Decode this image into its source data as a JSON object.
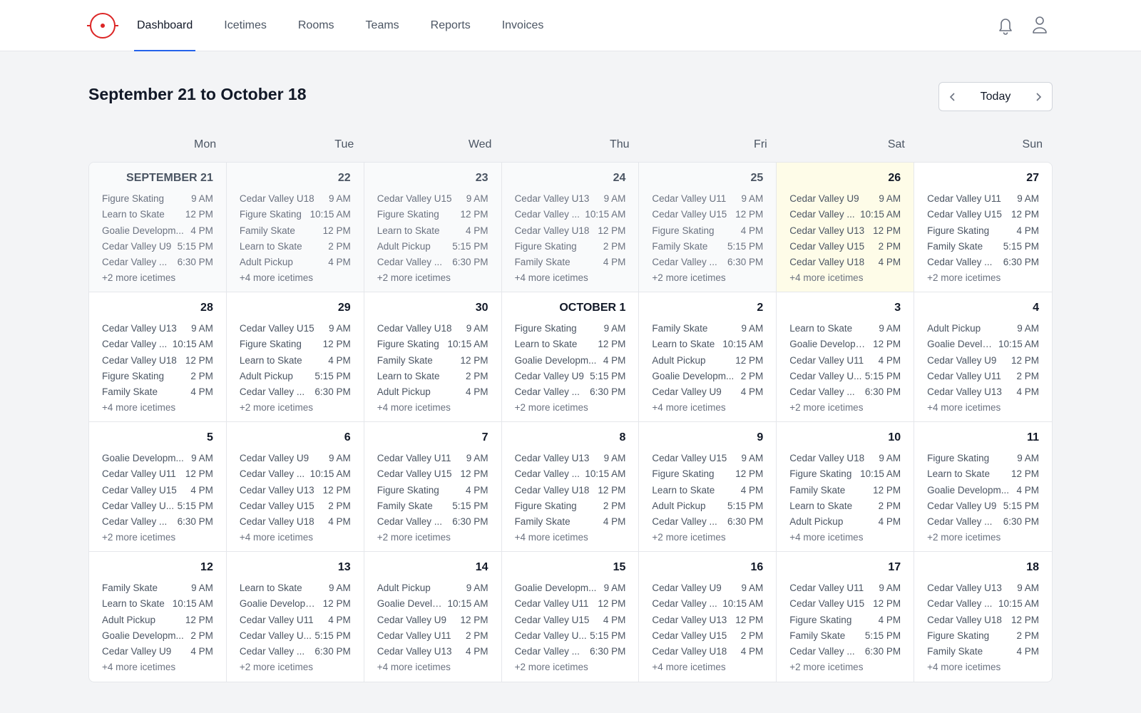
{
  "nav": {
    "tabs": [
      {
        "label": "Dashboard",
        "active": true
      },
      {
        "label": "Icetimes",
        "active": false
      },
      {
        "label": "Rooms",
        "active": false
      },
      {
        "label": "Teams",
        "active": false
      },
      {
        "label": "Reports",
        "active": false
      },
      {
        "label": "Invoices",
        "active": false
      }
    ],
    "icons": [
      "bell-icon",
      "user-icon"
    ],
    "accent_color": "#2563eb",
    "brand_color": "#dc2626"
  },
  "header": {
    "title": "September 21 to October 18",
    "today_label": "Today"
  },
  "calendar": {
    "weekdays": [
      "Mon",
      "Tue",
      "Wed",
      "Thu",
      "Fri",
      "Sat",
      "Sun"
    ],
    "today_color": "#fefce8",
    "days": [
      {
        "label": "SEPTEMBER 21",
        "state": "past",
        "events": [
          {
            "name": "Figure Skating",
            "time": "9 AM"
          },
          {
            "name": "Learn to Skate",
            "time": "12 PM"
          },
          {
            "name": "Goalie Developm...",
            "time": "4 PM"
          },
          {
            "name": "Cedar Valley U9",
            "time": "5:15 PM"
          },
          {
            "name": "Cedar Valley ...",
            "time": "6:30 PM"
          }
        ],
        "more": "+2 more icetimes"
      },
      {
        "label": "22",
        "state": "past",
        "events": [
          {
            "name": "Cedar Valley U18",
            "time": "9 AM"
          },
          {
            "name": "Figure Skating",
            "time": "10:15 AM"
          },
          {
            "name": "Family Skate",
            "time": "12 PM"
          },
          {
            "name": "Learn to Skate",
            "time": "2 PM"
          },
          {
            "name": "Adult Pickup",
            "time": "4 PM"
          }
        ],
        "more": "+4 more icetimes"
      },
      {
        "label": "23",
        "state": "past",
        "events": [
          {
            "name": "Cedar Valley U15",
            "time": "9 AM"
          },
          {
            "name": "Figure Skating",
            "time": "12 PM"
          },
          {
            "name": "Learn to Skate",
            "time": "4 PM"
          },
          {
            "name": "Adult Pickup",
            "time": "5:15 PM"
          },
          {
            "name": "Cedar Valley ...",
            "time": "6:30 PM"
          }
        ],
        "more": "+2 more icetimes"
      },
      {
        "label": "24",
        "state": "past",
        "events": [
          {
            "name": "Cedar Valley U13",
            "time": "9 AM"
          },
          {
            "name": "Cedar Valley ...",
            "time": "10:15 AM"
          },
          {
            "name": "Cedar Valley U18",
            "time": "12 PM"
          },
          {
            "name": "Figure Skating",
            "time": "2 PM"
          },
          {
            "name": "Family Skate",
            "time": "4 PM"
          }
        ],
        "more": "+4 more icetimes"
      },
      {
        "label": "25",
        "state": "past",
        "events": [
          {
            "name": "Cedar Valley U11",
            "time": "9 AM"
          },
          {
            "name": "Cedar Valley U15",
            "time": "12 PM"
          },
          {
            "name": "Figure Skating",
            "time": "4 PM"
          },
          {
            "name": "Family Skate",
            "time": "5:15 PM"
          },
          {
            "name": "Cedar Valley ...",
            "time": "6:30 PM"
          }
        ],
        "more": "+2 more icetimes"
      },
      {
        "label": "26",
        "state": "today",
        "events": [
          {
            "name": "Cedar Valley U9",
            "time": "9 AM"
          },
          {
            "name": "Cedar Valley ...",
            "time": "10:15 AM"
          },
          {
            "name": "Cedar Valley U13",
            "time": "12 PM"
          },
          {
            "name": "Cedar Valley U15",
            "time": "2 PM"
          },
          {
            "name": "Cedar Valley U18",
            "time": "4 PM"
          }
        ],
        "more": "+4 more icetimes"
      },
      {
        "label": "27",
        "state": "future",
        "events": [
          {
            "name": "Cedar Valley U11",
            "time": "9 AM"
          },
          {
            "name": "Cedar Valley U15",
            "time": "12 PM"
          },
          {
            "name": "Figure Skating",
            "time": "4 PM"
          },
          {
            "name": "Family Skate",
            "time": "5:15 PM"
          },
          {
            "name": "Cedar Valley ...",
            "time": "6:30 PM"
          }
        ],
        "more": "+2 more icetimes"
      },
      {
        "label": "28",
        "state": "future",
        "events": [
          {
            "name": "Cedar Valley U13",
            "time": "9 AM"
          },
          {
            "name": "Cedar Valley ...",
            "time": "10:15 AM"
          },
          {
            "name": "Cedar Valley U18",
            "time": "12 PM"
          },
          {
            "name": "Figure Skating",
            "time": "2 PM"
          },
          {
            "name": "Family Skate",
            "time": "4 PM"
          }
        ],
        "more": "+4 more icetimes"
      },
      {
        "label": "29",
        "state": "future",
        "events": [
          {
            "name": "Cedar Valley U15",
            "time": "9 AM"
          },
          {
            "name": "Figure Skating",
            "time": "12 PM"
          },
          {
            "name": "Learn to Skate",
            "time": "4 PM"
          },
          {
            "name": "Adult Pickup",
            "time": "5:15 PM"
          },
          {
            "name": "Cedar Valley ...",
            "time": "6:30 PM"
          }
        ],
        "more": "+2 more icetimes"
      },
      {
        "label": "30",
        "state": "future",
        "events": [
          {
            "name": "Cedar Valley U18",
            "time": "9 AM"
          },
          {
            "name": "Figure Skating",
            "time": "10:15 AM"
          },
          {
            "name": "Family Skate",
            "time": "12 PM"
          },
          {
            "name": "Learn to Skate",
            "time": "2 PM"
          },
          {
            "name": "Adult Pickup",
            "time": "4 PM"
          }
        ],
        "more": "+4 more icetimes"
      },
      {
        "label": "OCTOBER 1",
        "state": "future",
        "events": [
          {
            "name": "Figure Skating",
            "time": "9 AM"
          },
          {
            "name": "Learn to Skate",
            "time": "12 PM"
          },
          {
            "name": "Goalie Developm...",
            "time": "4 PM"
          },
          {
            "name": "Cedar Valley U9",
            "time": "5:15 PM"
          },
          {
            "name": "Cedar Valley ...",
            "time": "6:30 PM"
          }
        ],
        "more": "+2 more icetimes"
      },
      {
        "label": "2",
        "state": "future",
        "events": [
          {
            "name": "Family Skate",
            "time": "9 AM"
          },
          {
            "name": "Learn to Skate",
            "time": "10:15 AM"
          },
          {
            "name": "Adult Pickup",
            "time": "12 PM"
          },
          {
            "name": "Goalie Developm...",
            "time": "2 PM"
          },
          {
            "name": "Cedar Valley U9",
            "time": "4 PM"
          }
        ],
        "more": "+4 more icetimes"
      },
      {
        "label": "3",
        "state": "future",
        "events": [
          {
            "name": "Learn to Skate",
            "time": "9 AM"
          },
          {
            "name": "Goalie Developm...",
            "time": "12 PM"
          },
          {
            "name": "Cedar Valley U11",
            "time": "4 PM"
          },
          {
            "name": "Cedar Valley U...",
            "time": "5:15 PM"
          },
          {
            "name": "Cedar Valley ...",
            "time": "6:30 PM"
          }
        ],
        "more": "+2 more icetimes"
      },
      {
        "label": "4",
        "state": "future",
        "events": [
          {
            "name": "Adult Pickup",
            "time": "9 AM"
          },
          {
            "name": "Goalie Develo...",
            "time": "10:15 AM"
          },
          {
            "name": "Cedar Valley U9",
            "time": "12 PM"
          },
          {
            "name": "Cedar Valley U11",
            "time": "2 PM"
          },
          {
            "name": "Cedar Valley U13",
            "time": "4 PM"
          }
        ],
        "more": "+4 more icetimes"
      },
      {
        "label": "5",
        "state": "future",
        "events": [
          {
            "name": "Goalie Developm...",
            "time": "9 AM"
          },
          {
            "name": "Cedar Valley U11",
            "time": "12 PM"
          },
          {
            "name": "Cedar Valley U15",
            "time": "4 PM"
          },
          {
            "name": "Cedar Valley U...",
            "time": "5:15 PM"
          },
          {
            "name": "Cedar Valley ...",
            "time": "6:30 PM"
          }
        ],
        "more": "+2 more icetimes"
      },
      {
        "label": "6",
        "state": "future",
        "events": [
          {
            "name": "Cedar Valley U9",
            "time": "9 AM"
          },
          {
            "name": "Cedar Valley ...",
            "time": "10:15 AM"
          },
          {
            "name": "Cedar Valley U13",
            "time": "12 PM"
          },
          {
            "name": "Cedar Valley U15",
            "time": "2 PM"
          },
          {
            "name": "Cedar Valley U18",
            "time": "4 PM"
          }
        ],
        "more": "+4 more icetimes"
      },
      {
        "label": "7",
        "state": "future",
        "events": [
          {
            "name": "Cedar Valley U11",
            "time": "9 AM"
          },
          {
            "name": "Cedar Valley U15",
            "time": "12 PM"
          },
          {
            "name": "Figure Skating",
            "time": "4 PM"
          },
          {
            "name": "Family Skate",
            "time": "5:15 PM"
          },
          {
            "name": "Cedar Valley ...",
            "time": "6:30 PM"
          }
        ],
        "more": "+2 more icetimes"
      },
      {
        "label": "8",
        "state": "future",
        "events": [
          {
            "name": "Cedar Valley U13",
            "time": "9 AM"
          },
          {
            "name": "Cedar Valley ...",
            "time": "10:15 AM"
          },
          {
            "name": "Cedar Valley U18",
            "time": "12 PM"
          },
          {
            "name": "Figure Skating",
            "time": "2 PM"
          },
          {
            "name": "Family Skate",
            "time": "4 PM"
          }
        ],
        "more": "+4 more icetimes"
      },
      {
        "label": "9",
        "state": "future",
        "events": [
          {
            "name": "Cedar Valley U15",
            "time": "9 AM"
          },
          {
            "name": "Figure Skating",
            "time": "12 PM"
          },
          {
            "name": "Learn to Skate",
            "time": "4 PM"
          },
          {
            "name": "Adult Pickup",
            "time": "5:15 PM"
          },
          {
            "name": "Cedar Valley ...",
            "time": "6:30 PM"
          }
        ],
        "more": "+2 more icetimes"
      },
      {
        "label": "10",
        "state": "future",
        "events": [
          {
            "name": "Cedar Valley U18",
            "time": "9 AM"
          },
          {
            "name": "Figure Skating",
            "time": "10:15 AM"
          },
          {
            "name": "Family Skate",
            "time": "12 PM"
          },
          {
            "name": "Learn to Skate",
            "time": "2 PM"
          },
          {
            "name": "Adult Pickup",
            "time": "4 PM"
          }
        ],
        "more": "+4 more icetimes"
      },
      {
        "label": "11",
        "state": "future",
        "events": [
          {
            "name": "Figure Skating",
            "time": "9 AM"
          },
          {
            "name": "Learn to Skate",
            "time": "12 PM"
          },
          {
            "name": "Goalie Developm...",
            "time": "4 PM"
          },
          {
            "name": "Cedar Valley U9",
            "time": "5:15 PM"
          },
          {
            "name": "Cedar Valley ...",
            "time": "6:30 PM"
          }
        ],
        "more": "+2 more icetimes"
      },
      {
        "label": "12",
        "state": "future",
        "events": [
          {
            "name": "Family Skate",
            "time": "9 AM"
          },
          {
            "name": "Learn to Skate",
            "time": "10:15 AM"
          },
          {
            "name": "Adult Pickup",
            "time": "12 PM"
          },
          {
            "name": "Goalie Developm...",
            "time": "2 PM"
          },
          {
            "name": "Cedar Valley U9",
            "time": "4 PM"
          }
        ],
        "more": "+4 more icetimes"
      },
      {
        "label": "13",
        "state": "future",
        "events": [
          {
            "name": "Learn to Skate",
            "time": "9 AM"
          },
          {
            "name": "Goalie Developm...",
            "time": "12 PM"
          },
          {
            "name": "Cedar Valley U11",
            "time": "4 PM"
          },
          {
            "name": "Cedar Valley U...",
            "time": "5:15 PM"
          },
          {
            "name": "Cedar Valley ...",
            "time": "6:30 PM"
          }
        ],
        "more": "+2 more icetimes"
      },
      {
        "label": "14",
        "state": "future",
        "events": [
          {
            "name": "Adult Pickup",
            "time": "9 AM"
          },
          {
            "name": "Goalie Develo...",
            "time": "10:15 AM"
          },
          {
            "name": "Cedar Valley U9",
            "time": "12 PM"
          },
          {
            "name": "Cedar Valley U11",
            "time": "2 PM"
          },
          {
            "name": "Cedar Valley U13",
            "time": "4 PM"
          }
        ],
        "more": "+4 more icetimes"
      },
      {
        "label": "15",
        "state": "future",
        "events": [
          {
            "name": "Goalie Developm...",
            "time": "9 AM"
          },
          {
            "name": "Cedar Valley U11",
            "time": "12 PM"
          },
          {
            "name": "Cedar Valley U15",
            "time": "4 PM"
          },
          {
            "name": "Cedar Valley U...",
            "time": "5:15 PM"
          },
          {
            "name": "Cedar Valley ...",
            "time": "6:30 PM"
          }
        ],
        "more": "+2 more icetimes"
      },
      {
        "label": "16",
        "state": "future",
        "events": [
          {
            "name": "Cedar Valley U9",
            "time": "9 AM"
          },
          {
            "name": "Cedar Valley ...",
            "time": "10:15 AM"
          },
          {
            "name": "Cedar Valley U13",
            "time": "12 PM"
          },
          {
            "name": "Cedar Valley U15",
            "time": "2 PM"
          },
          {
            "name": "Cedar Valley U18",
            "time": "4 PM"
          }
        ],
        "more": "+4 more icetimes"
      },
      {
        "label": "17",
        "state": "future",
        "events": [
          {
            "name": "Cedar Valley U11",
            "time": "9 AM"
          },
          {
            "name": "Cedar Valley U15",
            "time": "12 PM"
          },
          {
            "name": "Figure Skating",
            "time": "4 PM"
          },
          {
            "name": "Family Skate",
            "time": "5:15 PM"
          },
          {
            "name": "Cedar Valley ...",
            "time": "6:30 PM"
          }
        ],
        "more": "+2 more icetimes"
      },
      {
        "label": "18",
        "state": "future",
        "events": [
          {
            "name": "Cedar Valley U13",
            "time": "9 AM"
          },
          {
            "name": "Cedar Valley ...",
            "time": "10:15 AM"
          },
          {
            "name": "Cedar Valley U18",
            "time": "12 PM"
          },
          {
            "name": "Figure Skating",
            "time": "2 PM"
          },
          {
            "name": "Family Skate",
            "time": "4 PM"
          }
        ],
        "more": "+4 more icetimes"
      }
    ]
  }
}
